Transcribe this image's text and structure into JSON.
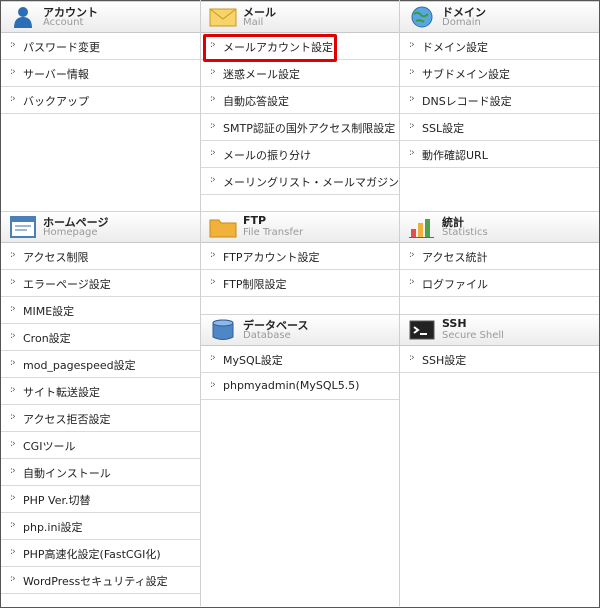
{
  "sections": {
    "account": {
      "title": "アカウント",
      "subtitle": "Account",
      "icon": "person-icon",
      "items": [
        "パスワード変更",
        "サーバー情報",
        "バックアップ"
      ]
    },
    "mail": {
      "title": "メール",
      "subtitle": "Mail",
      "icon": "envelope-icon",
      "items": [
        "メールアカウント設定",
        "迷惑メール設定",
        "自動応答設定",
        "SMTP認証の国外アクセス制限設定",
        "メールの振り分け",
        "メーリングリスト・メールマガジン"
      ]
    },
    "domain": {
      "title": "ドメイン",
      "subtitle": "Domain",
      "icon": "globe-icon",
      "items": [
        "ドメイン設定",
        "サブドメイン設定",
        "DNSレコード設定",
        "SSL設定",
        "動作確認URL"
      ]
    },
    "homepage": {
      "title": "ホームページ",
      "subtitle": "Homepage",
      "icon": "webpage-icon",
      "items": [
        "アクセス制限",
        "エラーページ設定",
        "MIME設定",
        "Cron設定",
        "mod_pagespeed設定",
        "サイト転送設定",
        "アクセス拒否設定",
        "CGIツール",
        "自動インストール",
        "PHP Ver.切替",
        "php.ini設定",
        "PHP高速化設定(FastCGI化)",
        "WordPressセキュリティ設定"
      ]
    },
    "ftp": {
      "title": "FTP",
      "subtitle": "File Transfer",
      "icon": "folder-icon",
      "items": [
        "FTPアカウント設定",
        "FTP制限設定"
      ]
    },
    "statistics": {
      "title": "統計",
      "subtitle": "Statistics",
      "icon": "bar-chart-icon",
      "items": [
        "アクセス統計",
        "ログファイル"
      ]
    },
    "database": {
      "title": "データベース",
      "subtitle": "Database",
      "icon": "database-icon",
      "items": [
        "MySQL設定",
        "phpmyadmin(MySQL5.5)"
      ]
    },
    "ssh": {
      "title": "SSH",
      "subtitle": "Secure Shell",
      "icon": "terminal-icon",
      "items": [
        "SSH設定"
      ]
    }
  },
  "highlighted_item": "メールアカウント設定",
  "colors": {
    "highlight": "#e00000",
    "divider": "#d9d9d9",
    "header_bg": "#ececec"
  }
}
